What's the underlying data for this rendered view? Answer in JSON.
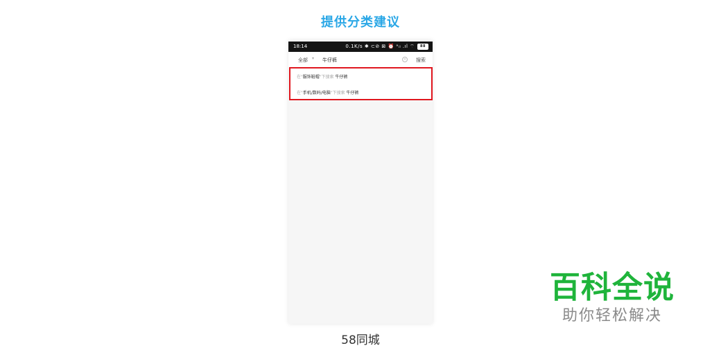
{
  "heading": "提供分类建议",
  "phone": {
    "status_bar": {
      "time": "18:14",
      "indicators": "0.1K/s ✱ ⊂⊘ ⊠ ⏰ ᵃᵢₗ .ıl ⌔",
      "battery": "88"
    },
    "search_bar": {
      "scope": "全部",
      "scope_arrow": "▾",
      "query": "牛仔裤",
      "clear_icon": "×",
      "search_button": "搜索"
    },
    "suggestions": [
      {
        "prefix": "在\"",
        "category": "服饰鞋帽",
        "middle": "\"下搜索",
        "keyword": "牛仔裤"
      },
      {
        "prefix": "在\"",
        "category": "手机/数码/电脑",
        "middle": "\"下搜索",
        "keyword": "牛仔裤"
      }
    ],
    "highlight_color": "#e0161e"
  },
  "caption": "58同城",
  "watermark": {
    "main": "百科全说",
    "sub": "助你轻松解决"
  },
  "colors": {
    "heading": "#2aa7e6",
    "watermark_main": "#1fb43b"
  }
}
